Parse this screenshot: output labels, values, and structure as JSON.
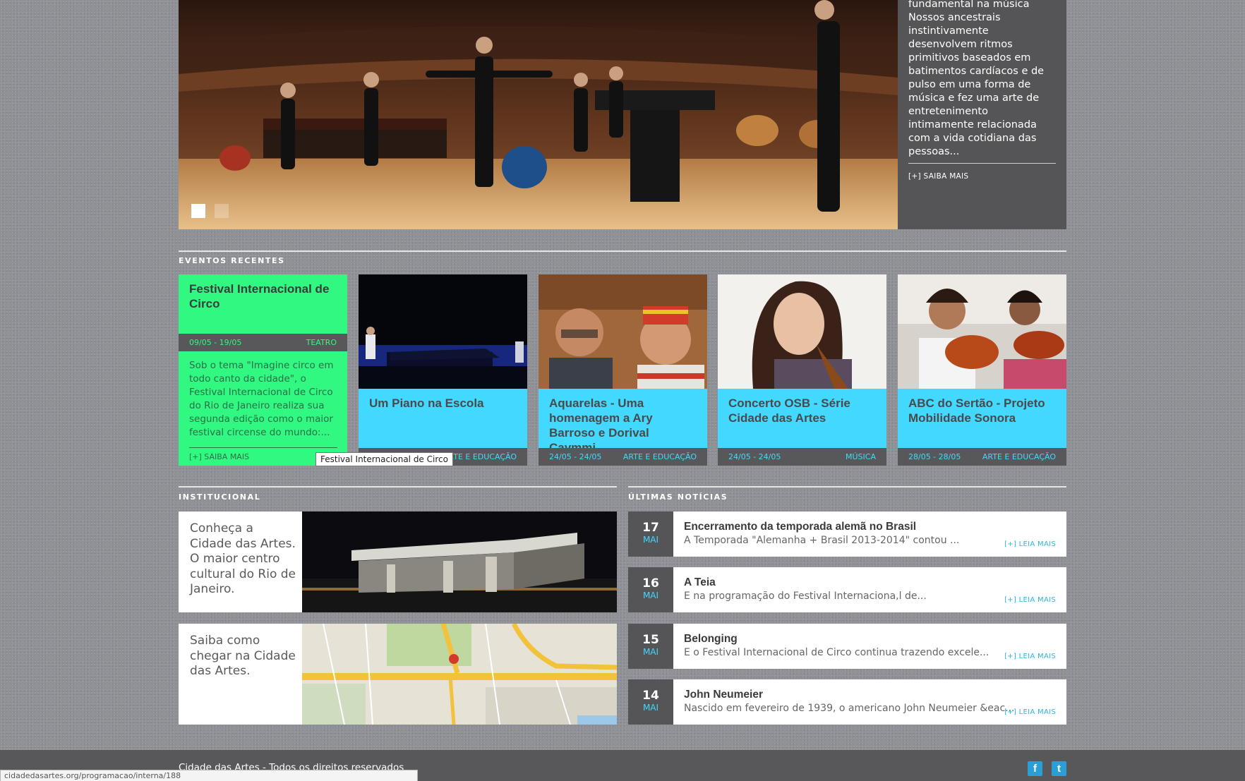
{
  "hero": {
    "text": "fundamental na música Nossos ancestrais instintivamente desenvolvem ritmos primitivos baseados em batimentos cardíacos e de pulso em uma forma de música e fez uma arte de entretenimento intimamente relacionada com a vida cotidiana das pessoas...",
    "more_label": "[+] SAIBA MAIS"
  },
  "sections": {
    "recent_events": "EVENTOS RECENTES",
    "institutional": "INSTITUCIONAL",
    "latest_news": "ÚLTIMAS NOTÍCIAS"
  },
  "events": [
    {
      "title": "Festival Internacional de Circo",
      "dates": "09/05 - 19/05",
      "category": "TEATRO",
      "description": "Sob o tema \"Imagine circo em todo canto da cidade\", o Festival Internacional de Circo do Rio de Janeiro realiza sua segunda edição como o maior festival circense do mundo:...",
      "more_label": "[+] SAIBA MAIS"
    },
    {
      "title": "Um Piano na Escola",
      "dates": "",
      "category": "ARTE E EDUCAÇÃO"
    },
    {
      "title": "Aquarelas - Uma homenagem a Ary Barroso e Dorival Caymmi",
      "dates": "24/05 - 24/05",
      "category": "ARTE E EDUCAÇÃO"
    },
    {
      "title": "Concerto OSB - Série Cidade das Artes",
      "dates": "24/05 - 24/05",
      "category": "MÚSICA"
    },
    {
      "title": "ABC do Sertão - Projeto Mobilidade Sonora",
      "dates": "28/05 - 28/05",
      "category": "ARTE E EDUCAÇÃO"
    }
  ],
  "tooltip": "Festival Internacional de Circo",
  "institutional": [
    {
      "text": "Conheça a Cidade das Artes. O maior centro cultural do Rio de Janeiro."
    },
    {
      "text": "Saiba como chegar na Cidade das Artes."
    }
  ],
  "news": [
    {
      "day": "17",
      "month": "MAI",
      "title": "Encerramento da temporada alemã no Brasil",
      "summary": "A Temporada \"Alemanha + Brasil 2013-2014\" contou ...",
      "more": "[+] LEIA MAIS"
    },
    {
      "day": "16",
      "month": "MAI",
      "title": "A Teia",
      "summary": "E na programação do Festival Internaciona,l de...",
      "more": "[+] LEIA MAIS"
    },
    {
      "day": "15",
      "month": "MAI",
      "title": "Belonging",
      "summary": "E o Festival Internacional de Circo continua trazendo excele...",
      "more": "[+] LEIA MAIS"
    },
    {
      "day": "14",
      "month": "MAI",
      "title": "John Neumeier",
      "summary": "Nascido em fevereiro de 1939, o americano John Neumeier &eac...",
      "more": "[+] LEIA MAIS"
    }
  ],
  "footer": {
    "text": "Cidade das Artes - Todos os direitos reservados",
    "facebook_icon": "f",
    "twitter_icon": "t"
  },
  "status_bar": "cidadedasartes.org/programacao/interna/188",
  "colors": {
    "green": "#30f880",
    "cyan": "#43d8ff",
    "dark": "#555557"
  }
}
